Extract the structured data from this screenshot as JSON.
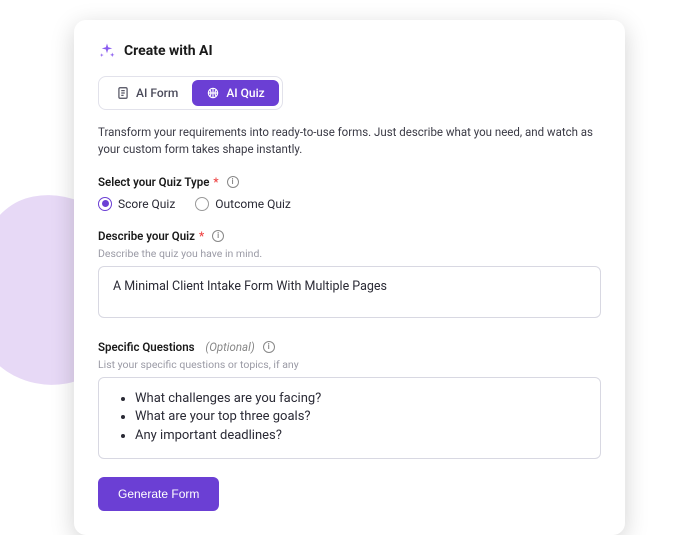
{
  "header": {
    "title": "Create with AI"
  },
  "tabs": {
    "form": "AI Form",
    "quiz": "AI Quiz"
  },
  "description": "Transform your requirements into ready-to-use forms. Just describe what you need, and watch as your custom form takes shape instantly.",
  "quizType": {
    "label": "Select your Quiz Type",
    "options": {
      "score": "Score Quiz",
      "outcome": "Outcome Quiz"
    }
  },
  "describe": {
    "label": "Describe your Quiz",
    "hint": "Describe the quiz you have in mind.",
    "value": "A Minimal Client Intake Form With Multiple Pages"
  },
  "specific": {
    "label": "Specific Questions",
    "optional": "(Optional)",
    "hint": "List your specific questions or topics, if any",
    "items": [
      "What challenges are you facing?",
      "What are your top three goals?",
      "Any important deadlines?"
    ]
  },
  "generateLabel": "Generate Form"
}
